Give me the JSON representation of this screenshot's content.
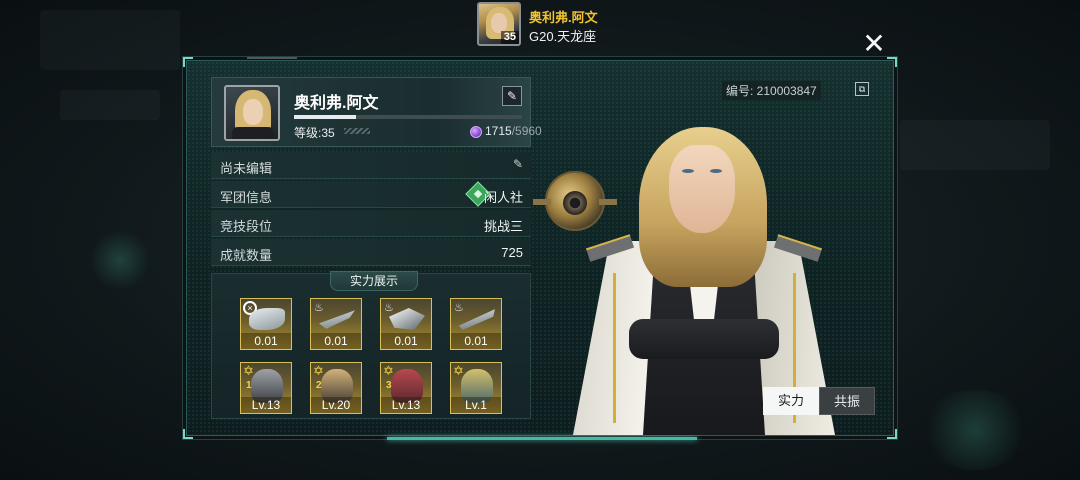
{
  "header": {
    "name": "奥利弗.阿文",
    "level_badge": "35",
    "server": "G20.天龙座"
  },
  "close_icon": "close-x-icon",
  "profile": {
    "name": "奥利弗.阿文",
    "level_label": "等级:35",
    "xp_progress_fraction": 0.27,
    "gem_current": "1715",
    "gem_max": "/5960",
    "edit_icon": "pencil-icon"
  },
  "info_rows": {
    "signature_label": "尚未编辑",
    "legion_label": "军团信息",
    "legion_value": "闲人社",
    "arena_label": "竞技段位",
    "arena_value": "挑战三",
    "achievement_label": "成就数量",
    "achievement_value": "725"
  },
  "showcase": {
    "title": "实力展示",
    "ships": [
      {
        "value": "0.01"
      },
      {
        "value": "0.01"
      },
      {
        "value": "0.01"
      },
      {
        "value": "0.01"
      }
    ],
    "heroes": [
      {
        "rank": "1",
        "level": "Lv.13"
      },
      {
        "rank": "2",
        "level": "Lv.20"
      },
      {
        "rank": "3",
        "level": "Lv.13"
      },
      {
        "rank": "",
        "level": "Lv.1"
      }
    ]
  },
  "player_id": "编号: 210003847",
  "tabs": {
    "strength": "实力",
    "resonance": "共振"
  },
  "colors": {
    "accent_gold": "#f2c230",
    "panel_bg": "#14302f",
    "slot_gold": "#d9bf58"
  }
}
